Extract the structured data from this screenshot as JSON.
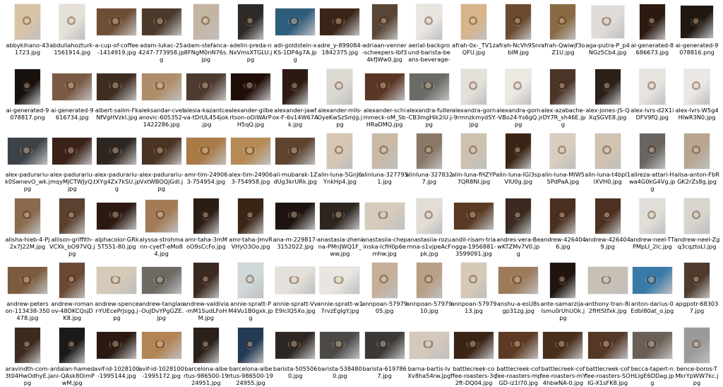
{
  "files": [
    {
      "name": "abbykihano-43\n1723.jpg",
      "tone": "#d8c3a5",
      "shape": "port"
    },
    {
      "name": "abdullahozturk-\n1561914.jpg",
      "tone": "#e6e1d8",
      "shape": "port"
    },
    {
      "name": "a-cup-of-coffee\n-1414919.jpg",
      "tone": "#6e4e35",
      "shape": "land"
    },
    {
      "name": "adam-lukac-25\n4247-773958.jp\ng",
      "tone": "#4b3a2b",
      "shape": "land"
    },
    {
      "name": "adam-stefanca-\n8FNgM0nN76s.\njpg",
      "tone": "#c4b5a2",
      "shape": "port"
    },
    {
      "name": "adelin-preda-n\nNxVmsXTGLU.j\npg",
      "tone": "#2e2a28",
      "shape": "port"
    },
    {
      "name": "adi-goldstein-x\nKS-1DP4g7A.jp\ng",
      "tone": "#2f5d7c",
      "shape": "land"
    },
    {
      "name": "adre_y-899084-\n1842375.jpg",
      "tone": "#3b2417",
      "shape": "land"
    },
    {
      "name": "adriaan-venner\n-scheepers-Ibf3\n4kfJWw0.jpg",
      "tone": "#5a4636",
      "shape": "port"
    },
    {
      "name": "aerial-backgro\nund-barista-be\nans-beverage-\nbreak-143049...",
      "tone": "#e9e6e2",
      "shape": "port"
    },
    {
      "name": "afrah-0x-_TV1z\nQFU.jpg",
      "tone": "#d7b48a",
      "shape": "port"
    },
    {
      "name": "afrah-NcVh9Snr\nblM.jpg",
      "tone": "#6b4a2f",
      "shape": "port"
    },
    {
      "name": "afrah-Qwiwjf3o\nZ1U.jpg",
      "tone": "#8a6a45",
      "shape": "port"
    },
    {
      "name": "aga-putra-P_p4\nNGz5Cb4.jpg",
      "tone": "#e0ddd8",
      "shape": "sq"
    },
    {
      "name": "ai-generated-8\n686673.jpg",
      "tone": "#2b1a10",
      "shape": "port"
    },
    {
      "name": "ai-generated-9\n078816.png",
      "tone": "#1e1712",
      "shape": "sq"
    },
    {
      "name": "ai-generated-9\n078817.png",
      "tone": "#17110d",
      "shape": "port"
    },
    {
      "name": "ai-generated-9\n616734.jpg",
      "tone": "#7a5a44",
      "shape": "land"
    },
    {
      "name": "albert-salim-Fk\nNfVgHVzkI.jpg",
      "tone": "#3f2d22",
      "shape": "land"
    },
    {
      "name": "aleksandar-cvet\nanovic-605352-\n1422286.jpg",
      "tone": "#b08d6a",
      "shape": "land"
    },
    {
      "name": "alesia-kazantce\nva-tDrUL454jok\n.jpg",
      "tone": "#4d3b2f",
      "shape": "land"
    },
    {
      "name": "alexander-gilbe\nrtson-oOiWArP\nH5qQ.jpg",
      "tone": "#1f0d08",
      "shape": "land"
    },
    {
      "name": "alexander-jawf\nox-F-6v14W67A\nk.jpg",
      "tone": "#2c1a12",
      "shape": "port"
    },
    {
      "name": "alexander-mils-\nOyeKwSzSmJg.j\npg",
      "tone": "#dcd8d2",
      "shape": "port"
    },
    {
      "name": "alexander-schi\nmmeck-oM_Sb\nHRaDMQ.jpg",
      "tone": "#5a3624",
      "shape": "land"
    },
    {
      "name": "alexandra-fuller\n-CB3mgHik2iU.j\npg",
      "tone": "#6a6a66",
      "shape": "land"
    },
    {
      "name": "alexandra-gorn\n-9rmnzkmydSY.\njpg",
      "tone": "#e4e0da",
      "shape": "port"
    },
    {
      "name": "alexandra-gorn\n-VBo24-Ys6gQ.j\npg",
      "tone": "#ece8e2",
      "shape": "port"
    },
    {
      "name": "alex-azabache-\nrDY7R_sh46E.jp\ng",
      "tone": "#4a3528",
      "shape": "port"
    },
    {
      "name": "alex-jones-JS-Q\nXqSGVE8.jpg",
      "tone": "#2a2019",
      "shape": "port"
    },
    {
      "name": "alex-lvrs-d2X1i\nDFV9fQ.jpg",
      "tone": "#e7e4df",
      "shape": "port"
    },
    {
      "name": "alex-lvrs-W5g4\nHIwR3N0.jpg",
      "tone": "#ebe8e3",
      "shape": "port"
    },
    {
      "name": "alex-padurariu-\nk0SwnevO_wk.j\npg",
      "tone": "#3c4248",
      "shape": "land"
    },
    {
      "name": "alex-padurariu-\nmqyMjCTWJyQ.\njpg",
      "tone": "#3a2218",
      "shape": "land"
    },
    {
      "name": "alex-padurariu-\ntXYg4Zx7kSU.jp\ng",
      "tone": "#2d2520",
      "shape": "land"
    },
    {
      "name": "alex-padurariu-\nVxtWBOQjGdI.j\npg",
      "tone": "#4a3324",
      "shape": "land"
    },
    {
      "name": "amr-tim-24906\n3-754954.jpg",
      "tone": "#a97a45",
      "shape": "land"
    },
    {
      "name": "alex-tim-24906\n3-754958.jpg",
      "tone": "#b58a55",
      "shape": "land"
    },
    {
      "name": "ali-mubarak-1Z\ndUg3krURk.jpg",
      "tone": "#5d4330",
      "shape": "land"
    },
    {
      "name": "alin-luna-5GnJ6\nYnkHp4.jpg",
      "tone": "#d6c7b4",
      "shape": "port"
    },
    {
      "name": "alinluna-327795\n1.jpg",
      "tone": "#c9b9a5",
      "shape": "port"
    },
    {
      "name": "alinluna-327832\n7.jpg",
      "tone": "#8a7968",
      "shape": "port"
    },
    {
      "name": "alin-luna-fHZYP\n7QR8NI.jpg",
      "tone": "#cfc1b0",
      "shape": "port"
    },
    {
      "name": "alin-luna-lGl3sp\nVIU0g.jpg",
      "tone": "#3b2417",
      "shape": "port"
    },
    {
      "name": "alin-luna-MlW5\n5PdPaA.jpg",
      "tone": "#d8cdbf",
      "shape": "port"
    },
    {
      "name": "alin-luna-t4bpI1\nlXVH0.jpg",
      "tone": "#d2c3b0",
      "shape": "port"
    },
    {
      "name": "alireza-attari-H\nwa4G0kG4Vg.jp\ng",
      "tone": "#6a6560",
      "shape": "port"
    },
    {
      "name": "alisa-anton-FbR\nGK2rZs8g.jpg",
      "tone": "#b8a690",
      "shape": "port"
    },
    {
      "name": "alisha-hieb-4-Pj\n2x7J22M.jpg",
      "tone": "#8a6a4d",
      "shape": "port"
    },
    {
      "name": "allison-griffith-\nVCXk_bO97VQ.j\npg",
      "tone": "#5c4030",
      "shape": "port"
    },
    {
      "name": "alphacolor-GRk\n5T551-80.jpg",
      "tone": "#2b1912",
      "shape": "land"
    },
    {
      "name": "alyssa-strohma\nnn-cyetT-eMo8\n4.jpg",
      "tone": "#a37b57",
      "shape": "sq"
    },
    {
      "name": "amr-taha-3mM\noO9sCcFo.jpg",
      "tone": "#2c1d14",
      "shape": "port"
    },
    {
      "name": "amr-taha-JmvR\nVHyO3Oo.jpg",
      "tone": "#3a2416",
      "shape": "port"
    },
    {
      "name": "ana-m-229817-\n3152022.jpg",
      "tone": "#1d1410",
      "shape": "land"
    },
    {
      "name": "anastasia-zheni\nna-PMnJWQ1F_\nww.jpg",
      "tone": "#2c2520",
      "shape": "land"
    },
    {
      "name": "anastasiia-chep\ninska-lcfH0p6e\nmhw.jpg",
      "tone": "#d6cbbc",
      "shape": "land"
    },
    {
      "name": "anastasiia-rozu\nmna-s1vjpeAcF\npk.jpg",
      "tone": "#e2ddd6",
      "shape": "port"
    },
    {
      "name": "andil-risam-tria\nngga-1956881-\n3599091.jpg",
      "tone": "#5a3a24",
      "shape": "land"
    },
    {
      "name": "andres-vera-Be\nwKTZMv7V0.jp\ng",
      "tone": "#3a2a20",
      "shape": "port"
    },
    {
      "name": "andrew-426404\n6.jpg",
      "tone": "#4a3020",
      "shape": "port"
    },
    {
      "name": "andrew-426404\n9.jpg",
      "tone": "#4d3222",
      "shape": "port"
    },
    {
      "name": "andrew-neel-TT\nPMpLI_2lc.jpg",
      "tone": "#e1ded9",
      "shape": "port"
    },
    {
      "name": "andrew-neel-Zg\nq3cqztoLI.jpg",
      "tone": "#d9d4cd",
      "shape": "port"
    },
    {
      "name": "andrew-peters\non-113438-350\n478.jpg",
      "tone": "#7c5b3e",
      "shape": "land"
    },
    {
      "name": "andrew-roman\nov-48DKCQsjD\nK8.jpg",
      "tone": "#6b4a34",
      "shape": "port"
    },
    {
      "name": "andrew-spence\nr-YUEcePrJsgg.j\npg",
      "tone": "#d5c9b8",
      "shape": "land"
    },
    {
      "name": "andrew-tanglao\n-OuJDvYPgGZE.\njpg",
      "tone": "#6d6963",
      "shape": "land"
    },
    {
      "name": "andrew-valdivia\n-mM1SudLFoH\nM.jpg",
      "tone": "#3b2a20",
      "shape": "port"
    },
    {
      "name": "annie-spratt-P\nM4Vu1B0gxk.jp\ng",
      "tone": "#cfd7d8",
      "shape": "port"
    },
    {
      "name": "annie-spratt-Vv\nE9lcIQ5Xo.jpg",
      "tone": "#e4e0da",
      "shape": "land"
    },
    {
      "name": "annie-spratt-w1\n7rvzEgIgY.jpg",
      "tone": "#e9e6e1",
      "shape": "land"
    },
    {
      "name": "annpoan-57979\n05.jpg",
      "tone": "#c6b09a",
      "shape": "port"
    },
    {
      "name": "annpoan-57979\n10.jpg",
      "tone": "#b89f86",
      "shape": "port"
    },
    {
      "name": "annpoan-57979\n13.jpg",
      "tone": "#d7c9b7",
      "shape": "port"
    },
    {
      "name": "anshu-a-esU8s\ngp31zg.jpg",
      "tone": "#9c7a5a",
      "shape": "land"
    },
    {
      "name": "ante-samarzija-\nlsmu0rUhUOk.j\npg",
      "tone": "#1f140e",
      "shape": "port"
    },
    {
      "name": "anthony-tran-8i\n2fHtStfxk.jpg",
      "tone": "#c8c0b5",
      "shape": "land"
    },
    {
      "name": "anton-darius-0\nEdbI80at_o.jpg",
      "tone": "#3a7aa8",
      "shape": "land"
    },
    {
      "name": "apgpotr-68303\n7.jpg",
      "tone": "#4f3b2e",
      "shape": "port"
    },
    {
      "name": "aravindth-com-\n3t04HwOdhyE.j\npg",
      "tone": "#3d2a1e",
      "shape": "port"
    },
    {
      "name": "ardalan-hamed\nani-QAsk8OimP\nwM.jpg",
      "tone": "#1a1a1a",
      "shape": "port"
    },
    {
      "name": "avif-id-1028100\n-1995144.jpg",
      "tone": "#2a1a12",
      "shape": "land"
    },
    {
      "name": "avif-id-1028100\n-1995172.jpg",
      "tone": "#b28456",
      "shape": "land"
    },
    {
      "name": "barcelona-albe\nrtus-986500-19\n24951.jpg",
      "tone": "#2b211b",
      "shape": "port"
    },
    {
      "name": "barcelona-albe\nrtus-986500-19\n24955.jpg",
      "tone": "#233a55",
      "shape": "port"
    },
    {
      "name": "barista-505506\n0.jpg",
      "tone": "#2d2622",
      "shape": "land"
    },
    {
      "name": "barista-538480\n0.jpg",
      "tone": "#4c4a47",
      "shape": "land"
    },
    {
      "name": "barista-619786\n7.jpg",
      "tone": "#3b3835",
      "shape": "land"
    },
    {
      "name": "barna-bartis-Iv\nXv8ha54rw.jpg",
      "tone": "#d3c8bb",
      "shape": "land"
    },
    {
      "name": "battlecreek-co\nffee-roasters-3q\n2ft-DQ04.jpg",
      "tone": "#3a2416",
      "shape": "land"
    },
    {
      "name": "battlecreek-cof\nfee-roasters-mp\nGD-iz1I70.jpg",
      "tone": "#5e3a22",
      "shape": "land"
    },
    {
      "name": "battlecreek-cof\nfee-roasters-mY\n4hbwNA-0.jpg",
      "tone": "#4a2e1c",
      "shape": "land"
    },
    {
      "name": "battlecreek-cof\nfee-roasters-SO\nIG-X1sFK8.jpg",
      "tone": "#553726",
      "shape": "land"
    },
    {
      "name": "becca-tapert-n\nHLIgE6DDag.jp\ng",
      "tone": "#6a5f55",
      "shape": "land"
    },
    {
      "name": "bence-boros-T\nMkrYpWW7kc.j\npg",
      "tone": "#9a9a98",
      "shape": "port"
    }
  ]
}
